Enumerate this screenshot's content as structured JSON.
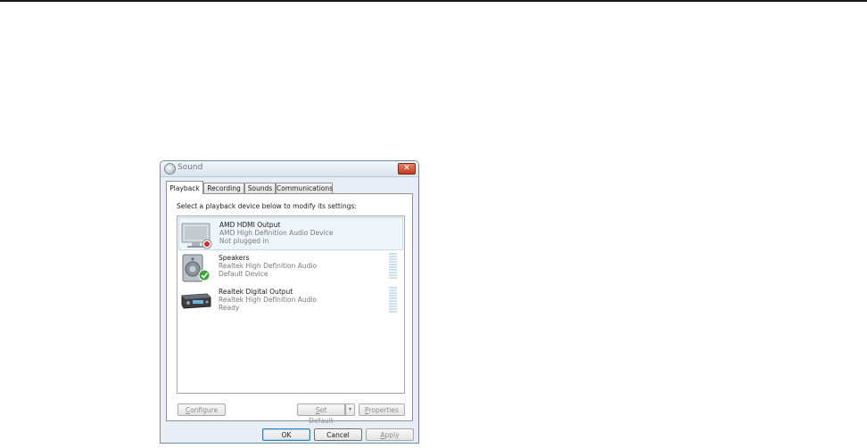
{
  "window": {
    "title": "Sound",
    "close_glyph": "✕"
  },
  "tabs": [
    {
      "label": "Playback",
      "active": true
    },
    {
      "label": "Recording",
      "active": false
    },
    {
      "label": "Sounds",
      "active": false
    },
    {
      "label": "Communications",
      "active": false
    }
  ],
  "panel": {
    "instruction": "Select a playback device below to modify its settings:"
  },
  "devices": [
    {
      "name": "AMD HDMI Output",
      "driver": "AMD High Definition Audio Device",
      "status": "Not plugged in",
      "icon": "monitor-icon",
      "badge": "unplugged-badge-icon",
      "selected": true
    },
    {
      "name": "Speakers",
      "driver": "Realtek High Definition Audio",
      "status": "Default Device",
      "icon": "speaker-icon",
      "badge": "default-check-icon",
      "selected": false
    },
    {
      "name": "Realtek Digital Output",
      "driver": "Realtek High Definition Audio",
      "status": "Ready",
      "icon": "digital-receiver-icon",
      "badge": "",
      "selected": false
    }
  ],
  "buttons": {
    "configure_pre": "",
    "configure_key": "C",
    "configure_post": "onfigure",
    "set_default_pre": "",
    "set_default_key": "S",
    "set_default_post": "et Default",
    "set_default_dropdown": "▾",
    "properties_pre": "",
    "properties_key": "P",
    "properties_post": "roperties",
    "ok": "OK",
    "cancel": "Cancel",
    "apply_pre": "",
    "apply_key": "A",
    "apply_post": "pply"
  },
  "colors": {
    "window_bg": "#e7eef5",
    "selection_bg": "#eef5fb",
    "meter": "#c9e2ec",
    "close_button": "#c23a1c",
    "check_green": "#3aa43a",
    "unplugged_red": "#d62b1f"
  }
}
